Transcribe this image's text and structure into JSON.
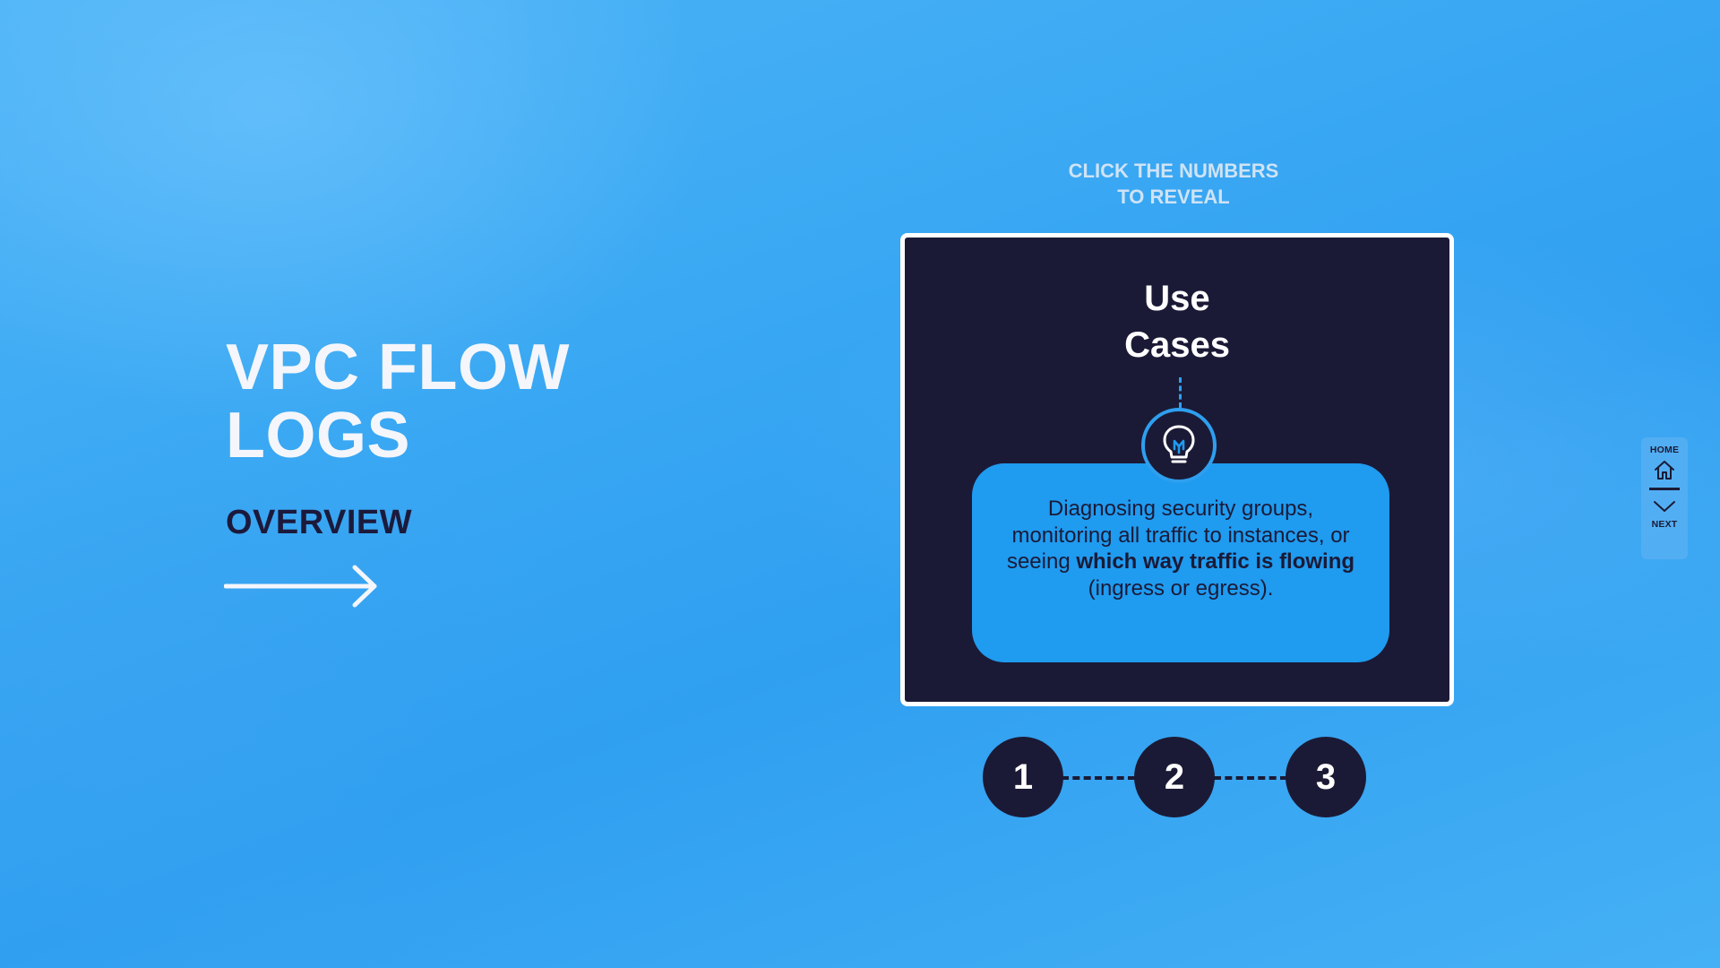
{
  "slide": {
    "title": "VPC FLOW LOGS",
    "subtitle": "OVERVIEW",
    "arrow_icon": "arrow-right-icon"
  },
  "hint": {
    "line1": "CLICK THE NUMBERS",
    "line2": "TO REVEAL"
  },
  "card": {
    "title_line1": "Use",
    "title_line2": "Cases",
    "icon": "lightbulb-icon",
    "text_before": "Diagnosing security groups, monitoring all traffic to instances, or seeing ",
    "text_bold": "which way traffic is flowing",
    "text_after": " (ingress or egress)."
  },
  "steps": [
    "1",
    "2",
    "3"
  ],
  "nav": {
    "home_label": "HOME",
    "next_label": "NEXT",
    "home_icon": "home-icon",
    "next_icon": "chevron-down-icon"
  },
  "colors": {
    "navy": "#1b1a36",
    "accent_blue": "#1f9bf0",
    "title_white": "#f4f6fb"
  }
}
